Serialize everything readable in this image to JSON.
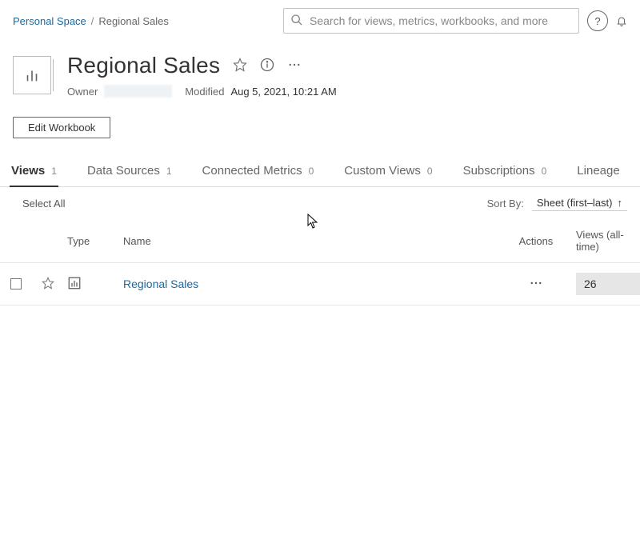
{
  "breadcrumb": {
    "parent": "Personal Space",
    "current": "Regional Sales"
  },
  "search": {
    "placeholder": "Search for views, metrics, workbooks, and more"
  },
  "header": {
    "title": "Regional Sales",
    "owner_label": "Owner",
    "modified_label": "Modified",
    "modified_value": "Aug 5, 2021, 10:21 AM",
    "edit_button": "Edit Workbook"
  },
  "tabs": [
    {
      "label": "Views",
      "count": "1",
      "active": true
    },
    {
      "label": "Data Sources",
      "count": "1",
      "active": false
    },
    {
      "label": "Connected Metrics",
      "count": "0",
      "active": false
    },
    {
      "label": "Custom Views",
      "count": "0",
      "active": false
    },
    {
      "label": "Subscriptions",
      "count": "0",
      "active": false
    },
    {
      "label": "Lineage",
      "count": "",
      "active": false
    }
  ],
  "toolbar": {
    "select_all": "Select All",
    "sort_by_label": "Sort By:",
    "sort_value": "Sheet (first–last)"
  },
  "columns": {
    "type": "Type",
    "name": "Name",
    "actions": "Actions",
    "views": "Views (all-time)"
  },
  "rows": [
    {
      "name": "Regional Sales",
      "views": "26"
    }
  ],
  "icons": {
    "help": "?",
    "sort_arrow": "↑"
  }
}
